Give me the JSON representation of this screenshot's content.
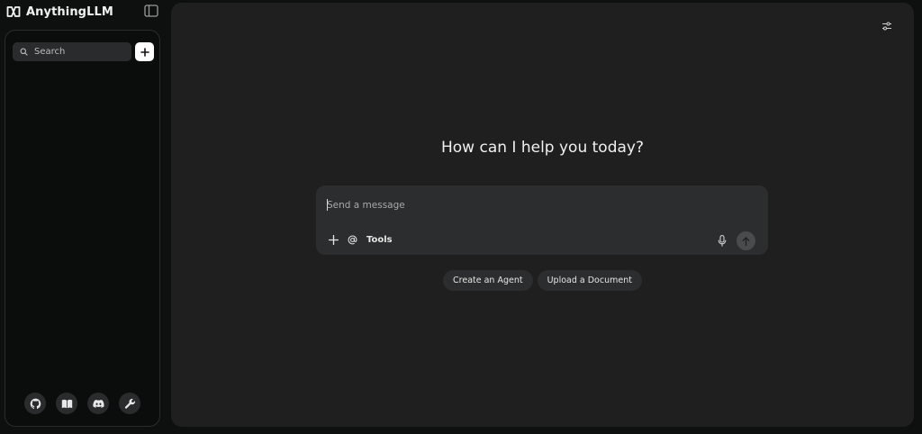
{
  "brand": {
    "name": "AnythingLLM"
  },
  "sidebar": {
    "search": {
      "placeholder": "Search"
    },
    "new_button_symbol": "+",
    "footer_icons": [
      "github-icon",
      "book-icon",
      "discord-icon",
      "wrench-icon"
    ]
  },
  "main": {
    "greeting": "How can I help you today?",
    "composer": {
      "placeholder": "Send a message",
      "tools_label": "Tools"
    },
    "suggestions": [
      {
        "label": "Create an Agent"
      },
      {
        "label": "Upload a Document"
      }
    ]
  },
  "colors": {
    "background": "#0e0f0f",
    "panel": "#1f1f20",
    "composer": "#2c2d2e",
    "accent_white": "#ffffff"
  }
}
